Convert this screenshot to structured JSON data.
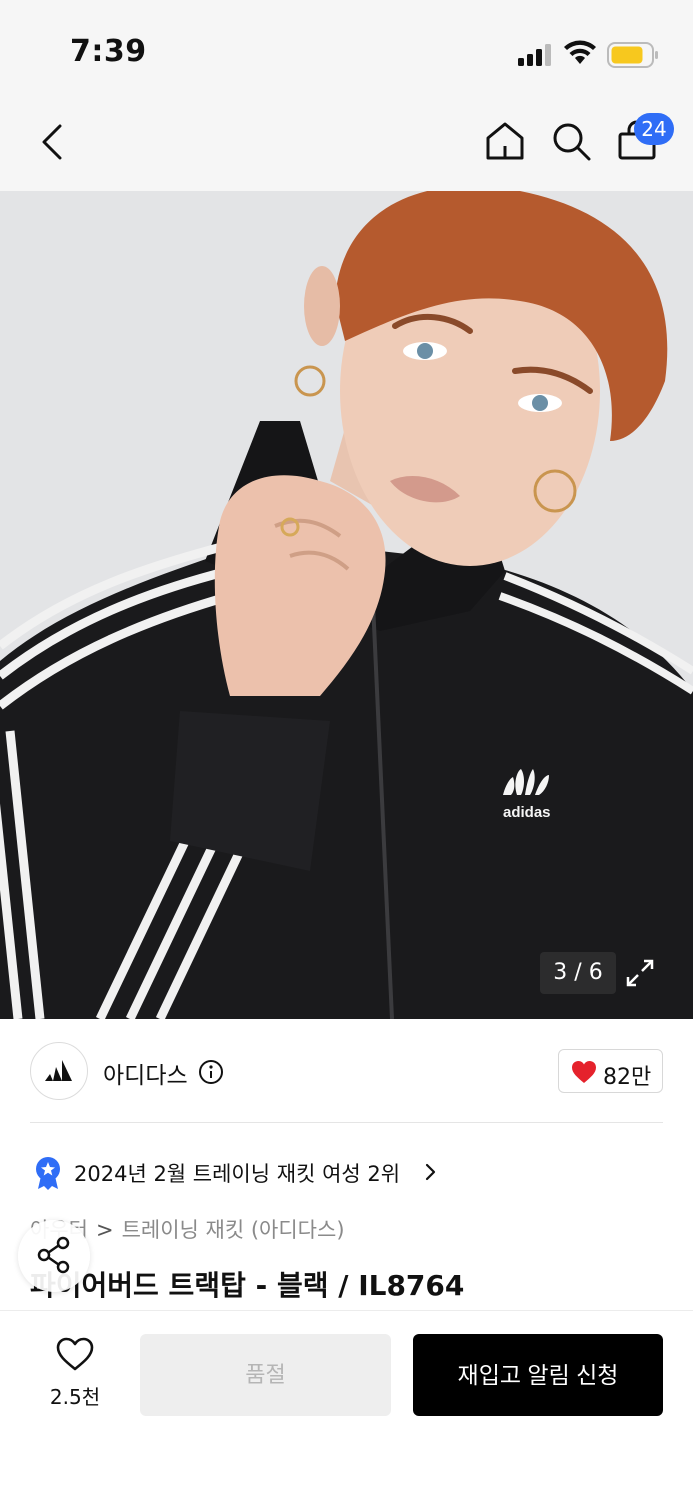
{
  "status_bar": {
    "time": "7:39"
  },
  "nav": {
    "cart_count": "24"
  },
  "product_image": {
    "counter": "3 / 6",
    "logo_text": "adidas"
  },
  "brand": {
    "name": "아디다스",
    "like_count": "82만"
  },
  "ranking": {
    "text": "2024년 2월 트레이닝 재킷 여성 2위"
  },
  "breadcrumb": {
    "items": [
      "아우터",
      "트레이닝 재킷 (아디다스)"
    ]
  },
  "product": {
    "title": "파이어버드 트랙탑 - 블랙 / IL8764"
  },
  "bottom_bar": {
    "wish_count": "2.5천",
    "soldout_label": "품절",
    "restock_label": "재입고 알림 신청"
  },
  "colors": {
    "accent_blue": "#2f6df6",
    "heart_red": "#e5222c",
    "battery_yellow": "#f7c81e",
    "button_black": "#000000",
    "disabled_gray": "#eeeeee"
  }
}
